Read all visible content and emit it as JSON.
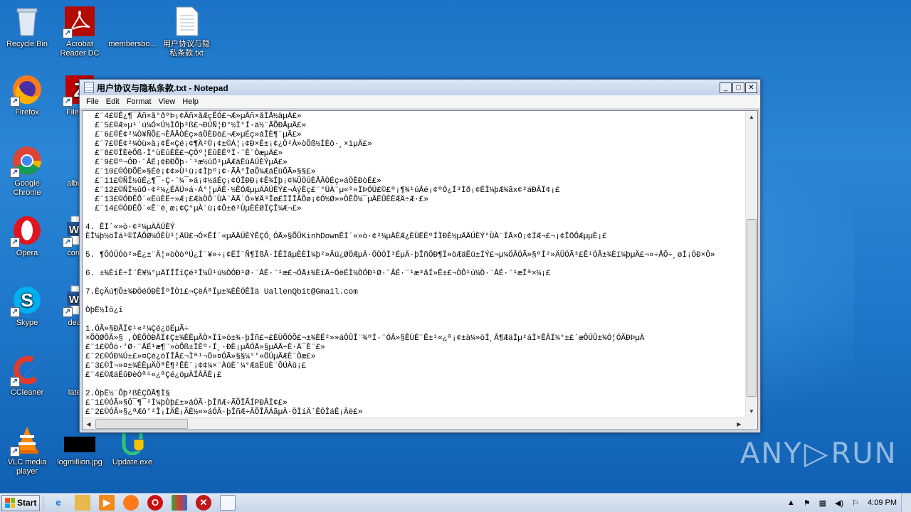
{
  "desktop": {
    "icons": [
      {
        "label": "Recycle Bin"
      },
      {
        "label": "Acrobat Reader DC"
      },
      {
        "label": "membersbo..."
      },
      {
        "label": "用户协议与隐私条款.txt"
      },
      {
        "label": "Firefox"
      },
      {
        "label": "FileZilla"
      },
      {
        "label": "Google Chrome"
      },
      {
        "label": "albumn"
      },
      {
        "label": "Opera"
      },
      {
        "label": "comple"
      },
      {
        "label": "Skype"
      },
      {
        "label": "deathv"
      },
      {
        "label": "CCleaner"
      },
      {
        "label": "latestn"
      },
      {
        "label": "VLC media player"
      },
      {
        "label": "logmillion.jpg"
      },
      {
        "label": "Update.exe"
      }
    ]
  },
  "notepad": {
    "title": "用户协议与隐私条款.txt - Notepad",
    "menu": [
      "File",
      "Edit",
      "Format",
      "View",
      "Help"
    ],
    "lines": [
      "  £¨4£©Ê¿¶¯Ãñ×å°ðºÞ¡¢Ãñ×åÆçÊÓ£¬Æ»µÃñ×åÌÅ½äµÄ£»",
      "  £¨5£©Æ»µ¹´ú¼Ó×Ú½ÌÖþ²ß£¬ÐÚÑ¦Ð°½Ì°Í·ä½¨ÃÕÐÅµÄ£»",
      "  £¨6£©É¢²¼Ò¥ÑÔ£¬ÈÅÂÒÉç»áÖÈÐò£¬Æ»µÉç»áÎÈ¶¨µÄ£»",
      "  £¨7£©É¢²¼Òù»à¡¢É«Çé¡¢¶Ä²©¡¢±©Á¦¡¢Ð×É±¡¢¿Ö²À»òÕß½ÌÈô·¸×ïµÄ£»",
      "  £¨8£©Î­ÈèÕß·Ì°ùËûÈË£¬ÇÖº¦ËûÈËºÏ·¨È¨ÒæµÄ£»",
      "  £¨9£©º¬ÓÐ·¨ÂÉ¡¢ÐÐÕþ·¨¹æ½ûÖ¹µÄÆäËûÄÚÈÝµÄ£»",
      "  £¨10£©ÓÐÕË»§Éè¡¢¢»Ù¹ù¡¢Ìþº¡¢·ÃÂ°ÎøÕ¾ÆäËüÔÃ»§§£»",
      "  £¨11£©ÑÏ½ûÉ¿¶¯·Ç·¨¼¯»á¡¢½áÉç¡¢ÓÎÐÐ¡¢Ê¾Íþ¡¢¾ÛÖÚÈÅÂÒÉç»áÖÈÐòÉ£»",
      "  £¨12£©ÑÏ½ûÓ·¢²¼¿ÉÄÜ»á·Á°¦µÄÉ·½ÊÓÆµµÄÄÚÈÝ£¬ÀýÈç£¨°ÜÀ¨µ«²»ÏÞÓÚ£©£º¡¶¾¹úÂé¡¢ºÓ¿Í³Ìð¡¢ÉÌ¼þÆ¾ãx¢²áÐÂÏ¢¡£",
      "  £¨13£©ÓÐÊÔ´«ËûÈË÷»Æ¡£ÆäÒÔ¨ÙÀ¨ÄÃ´Ó»¥Ä³Îø£ÏÏÎÂÕø¡¢Ó½Ø»»ÒÊÕ¼¯µÄËÛÈËÆÄ÷Æ·£»",
      "  £¨14£©ÓÐÊÔ´«Ê¨ë¸æ¡¢Ç°µÀ´ù¡¢Ö±ê²ÙµÈÉØÏÇÎ¼Æ¬£»",
      "",
      "4. ÊÍ´«»ò·¢²¼µÄÄÚÈÝ",
      "ÈÎ¼þ½öÎá¹©ÏÂÔØ¼ÓÈÙ¹¦ÄÜ£¬Ó×ÊÍ´«µÄÄÚÈÝÊÇÓ¸ÓÃ»§ÕÛKinhDownÊÍ´«»ò·¢²¼µÄÈÆ¿ÈÙËÈºÍÌÐÈ½µÄÄÚÈÝ°ÙÀ¨ÍÃ×Ö¡¢ÍÆ¬£¬¡¢ÎÖÔÆµµÈ¡£",
      "",
      "5. ¶ÔÓÚÓò²»Ê¿±¨Ä¦»òÒòºÚ¿Í¨¥»÷¡¢ËÍ¨Ñ¶ÏßÂ·ÌÊÌâµÈÈÌ¼þ²»Äü¿ØÖÆµÄ·ÖÒÓÌ³ÉµÄ·þÎñÖÐ¶Ï»òÆäËü±ÍÝ£¬µ¼ÖÂÓÃ»§ºÍ²»ÄÜÓÃ³£Ê¹ÓÃ±¾Èí¼þµÄ£¬»÷ÅÔ÷¸øÍ¡ÓÐ×Ô»",
      "",
      "6. ±¾ÈíÈ÷Í¨Ê¥¼°µÄÏÎÎîÇé²Î¼Û¹ú¼ÒÓÐ¹Ø·¨ÂÉ·¨¹æ£¬ÓÃ±¾ÈíÃ÷ÓëÉÌ¼ÒÓÐ¹Ø·¨ÂÉ·¨¹æ³åÍ»Ê±£¬ÒÔ¹ú¼Ò·¨ÂÉ·¨¹æÎª×¼¡£",
      "",
      "7.ÈçÄú¶Ô±¾Ð­ÒéÓÐÈÎºÎÒì£¬ÇëÁªÏµ±¾ÈËÓÊÏä UallenQbit@Gmail.com",
      "",
      "ÒþË½Ìõ¿î",
      "",
      "1.ÓÃ»§ÐÅÏ¢¹«²¼Çé¿öËµÃ÷",
      "×ÕÒØÔÃ»§ ,ÒÈÕÒÐÅÏ¢Ç±¾ÈËµÃÒ×Ïî»ò±¾·þÎñ£¬£ÈÙÕÒÕ£¬±¾ÈË²»»áÔÛÎ¨¾­ºÍ·¨ÓÃ»§ÊÙÈ¨Ê±¹«¿ª¡¢±à¼­»òÍ¸Â¶ÆäÌµ²áÏ×ÊÂÏ¼°±£´æÔÚÛ±¾Ó¦ÓÃÐÞµÄ",
      "£¨1£©Ôö·'Ø·¨ÂÉ¹æ¶¨»òÕß±ÏÈº·Í¸·ÐÈ¡µÃÓÃ»§µÄÃ÷È·Ä¯È¨£»",
      "£¨2£©ÓÐ¼Ú±£»¤Çé¿öÏÎÂ£¬Ìª¹¬Ö»¤ÓÃ»§§¼°'«ÖÚµÄÆÈ¨Òæ£»",
      "£¨3£©Î¬»¤±¾ÈËµÄÖªÊ¶²ÊÈ¨¡¢¢¼×¨ÀûÈ¨¼°ÆäËüÈ¨ÔÚÀû¡£",
      "£¨4£©ÆäËûÐèÒª¹«¿ªÇé¿öµÄÏÂÂÈ¡£",
      "",
      "2.ÒþË½¨Ôþ²ßÈÇÖÂ¶Ì§",
      "£¨1£©ÓÃ»§Ö¯¶¯²Ì¼þÒþ£±»áÓÃ·þÎñÆ÷ÃÕÎÃÍPÐÂÏ¢£»",
      "£¨2£©ÓÃ»§¿ªÆô'²Î¡ÌÄÊ¡ÃÈ½«»áÓÃ·þÎñÆ÷ÃÕÎÃÁãµÄ·ÖÏíÄ´ÊÓÎáÊ¡Äë£»"
    ]
  },
  "watermark": {
    "left": "ANY",
    "right": "RUN"
  },
  "taskbar": {
    "start_label": "Start",
    "clock": "4:09 PM"
  }
}
